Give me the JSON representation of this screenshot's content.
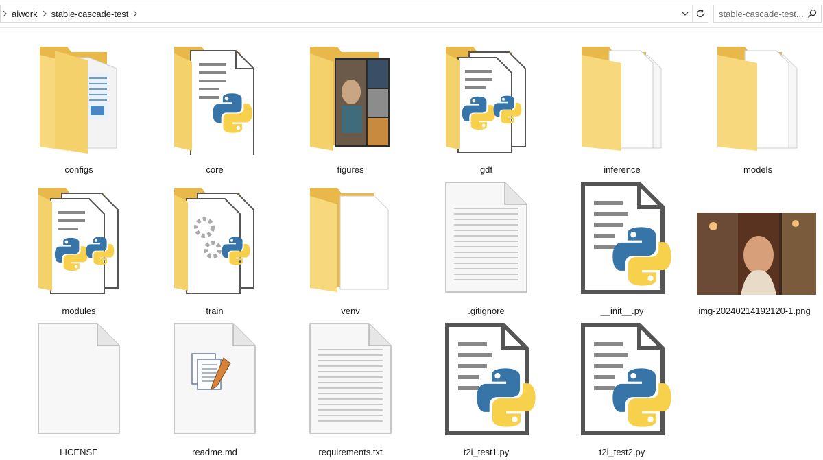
{
  "address_bar": {
    "breadcrumbs": [
      "aiwork",
      "stable-cascade-test"
    ]
  },
  "search": {
    "placeholder": "stable-cascade-test..."
  },
  "items": [
    {
      "name": "configs",
      "kind": "folder"
    },
    {
      "name": "core",
      "kind": "folder"
    },
    {
      "name": "figures",
      "kind": "folder"
    },
    {
      "name": "gdf",
      "kind": "folder"
    },
    {
      "name": "inference",
      "kind": "folder"
    },
    {
      "name": "models",
      "kind": "folder"
    },
    {
      "name": "modules",
      "kind": "folder"
    },
    {
      "name": "train",
      "kind": "folder"
    },
    {
      "name": "venv",
      "kind": "folder"
    },
    {
      "name": ".gitignore",
      "kind": "text-file"
    },
    {
      "name": "__init__.py",
      "kind": "python-file"
    },
    {
      "name": "img-20240214192120-1.png",
      "kind": "image-file"
    },
    {
      "name": "LICENSE",
      "kind": "blank-file"
    },
    {
      "name": "readme.md",
      "kind": "markdown-file"
    },
    {
      "name": "requirements.txt",
      "kind": "text-file"
    },
    {
      "name": "t2i_test1.py",
      "kind": "python-file"
    },
    {
      "name": "t2i_test2.py",
      "kind": "python-file"
    }
  ],
  "colors": {
    "folder": "#f5d16b",
    "folder_dark": "#e8b94a",
    "python_blue": "#3775a9",
    "python_yellow": "#f7d14c"
  }
}
